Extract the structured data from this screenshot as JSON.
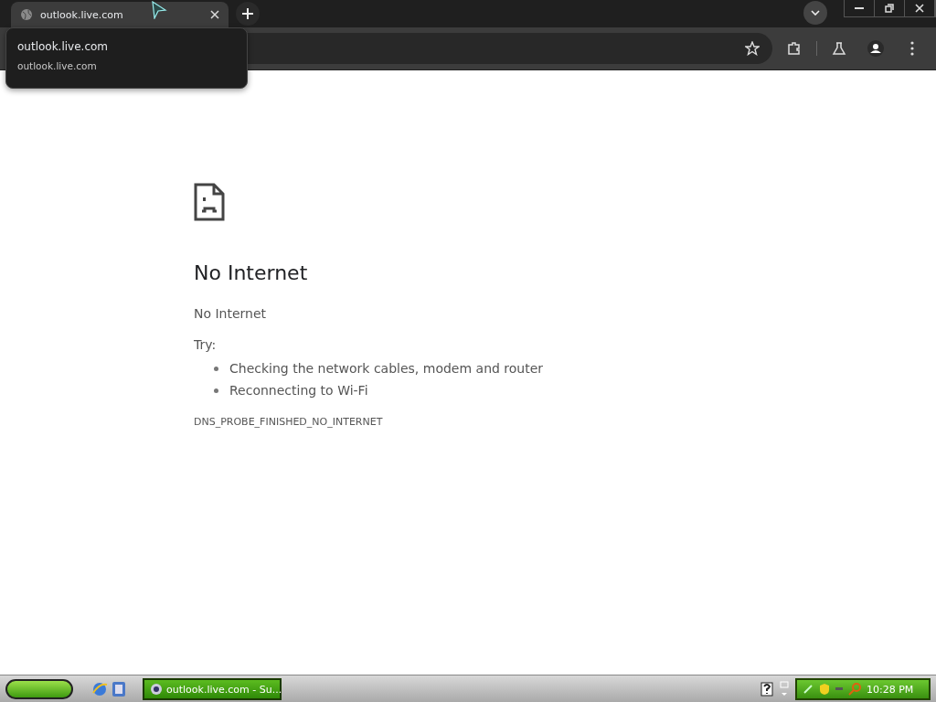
{
  "tabs": [
    {
      "title": "outlook.live.com",
      "selected": true
    }
  ],
  "tooltip": {
    "title": "outlook.live.com",
    "url": "outlook.live.com"
  },
  "error": {
    "heading": "No Internet",
    "message": "No Internet",
    "try_label": "Try:",
    "suggestions": [
      "Checking the network cables, modem and router",
      "Reconnecting to Wi-Fi"
    ],
    "code": "DNS_PROBE_FINISHED_NO_INTERNET"
  },
  "taskbar": {
    "tasks": [
      {
        "title": "outlook.live.com - Su...",
        "selected": true
      }
    ],
    "clock": "10:28 PM"
  }
}
